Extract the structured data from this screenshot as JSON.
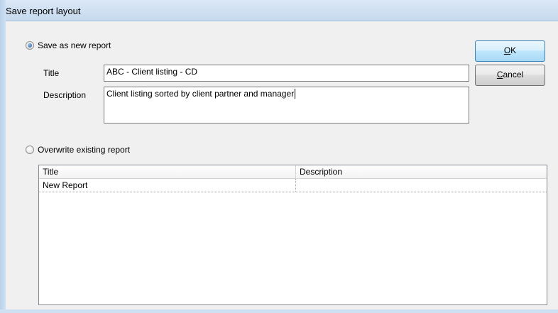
{
  "window": {
    "title": "Save report layout"
  },
  "save_new": {
    "label": "Save as new report",
    "selected": true,
    "title_label": "Title",
    "title_value": "ABC - Client listing - CD",
    "description_label": "Description",
    "description_value": "Client listing sorted by client partner and manager"
  },
  "overwrite": {
    "label": "Overwrite existing report",
    "selected": false
  },
  "buttons": {
    "ok_mnemonic": "O",
    "ok_rest": "K",
    "cancel_mnemonic": "C",
    "cancel_rest": "ancel"
  },
  "report_list": {
    "columns": [
      "Title",
      "Description"
    ],
    "rows": [
      {
        "title": "New Report",
        "description": ""
      }
    ]
  }
}
